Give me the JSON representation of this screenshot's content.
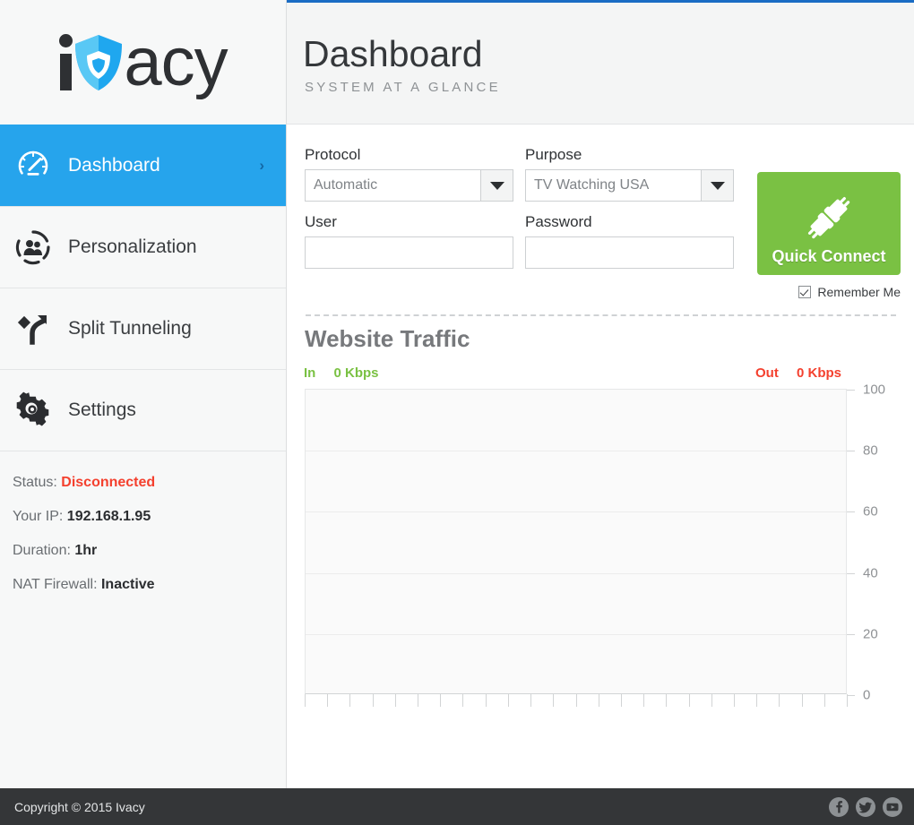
{
  "app": {
    "brand": "ivacy",
    "accent_blue": "#26a4ec",
    "accent_green": "#7ac143",
    "accent_red": "#f4402e",
    "header_rule_blue": "#1a6cc4"
  },
  "header": {
    "title": "Dashboard",
    "subtitle": "SYSTEM AT A GLANCE"
  },
  "sidebar": {
    "items": [
      {
        "label": "Dashboard",
        "icon": "speedometer-icon",
        "active": true,
        "chevron": "›"
      },
      {
        "label": "Personalization",
        "icon": "users-circle-icon",
        "active": false
      },
      {
        "label": "Split Tunneling",
        "icon": "split-arrow-icon",
        "active": false
      },
      {
        "label": "Settings",
        "icon": "gear-wrench-icon",
        "active": false
      }
    ],
    "status": {
      "status_label": "Status:",
      "status_value": "Disconnected",
      "ip_label": "Your IP:",
      "ip_value": "192.168.1.95",
      "duration_label": "Duration:",
      "duration_value": "1hr",
      "nat_label": "NAT Firewall:",
      "nat_value": "Inactive"
    }
  },
  "form": {
    "protocol": {
      "label": "Protocol",
      "value": "Automatic"
    },
    "purpose": {
      "label": "Purpose",
      "value": "TV Watching USA"
    },
    "user": {
      "label": "User",
      "value": "",
      "placeholder": ""
    },
    "password": {
      "label": "Password",
      "value": "",
      "placeholder": ""
    },
    "quick_connect": {
      "label": "Quick Connect",
      "icon": "plug-connect-icon"
    },
    "remember_me": {
      "label": "Remember Me",
      "checked": true
    }
  },
  "chart_data": {
    "type": "line",
    "title": "Website Traffic",
    "xlabel": "",
    "ylabel": "",
    "ylim": [
      0,
      100
    ],
    "yticks": [
      0,
      20,
      40,
      60,
      80,
      100
    ],
    "ytick_labels": [
      "0",
      "20",
      "40",
      "60",
      "80",
      "100"
    ],
    "xticks_count": 24,
    "xtick_labels": [],
    "grid": true,
    "legend_position": "top",
    "series": [
      {
        "name": "In",
        "color": "#7ac143",
        "current_value": "0 Kbps",
        "values": []
      },
      {
        "name": "Out",
        "color": "#f4402e",
        "current_value": "0 Kbps",
        "values": []
      }
    ]
  },
  "footer": {
    "copyright": "Copyright © 2015 Ivacy",
    "socials": [
      {
        "name": "facebook-icon",
        "glyph": "f"
      },
      {
        "name": "twitter-icon",
        "glyph": "t"
      },
      {
        "name": "youtube-icon",
        "glyph": "y"
      }
    ]
  }
}
